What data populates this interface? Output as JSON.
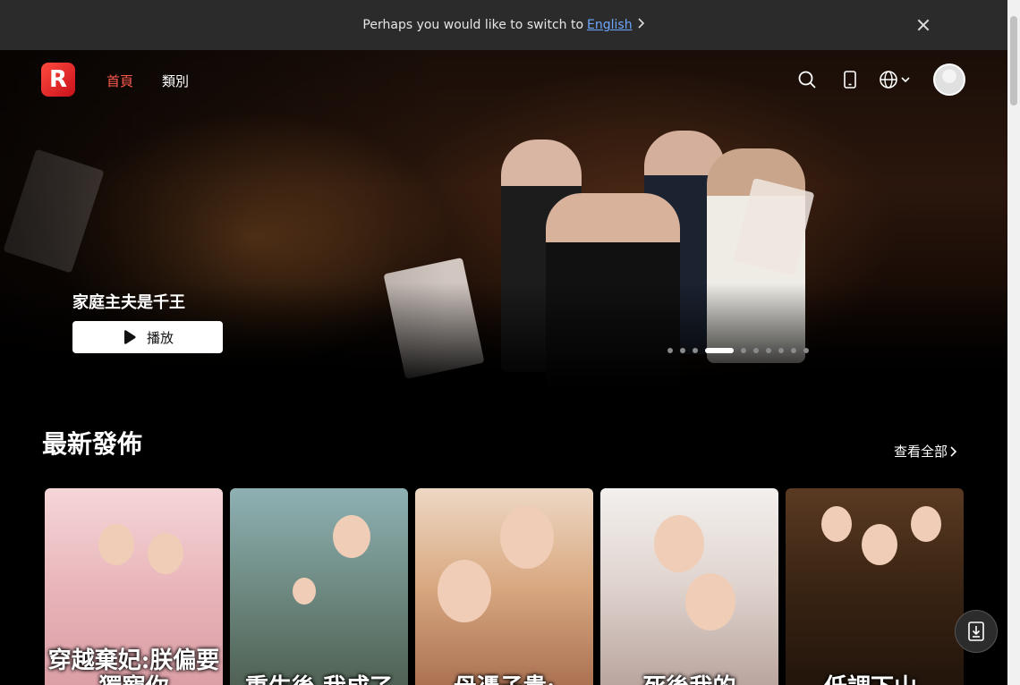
{
  "banner": {
    "text": "Perhaps you would like to switch to",
    "link": "English"
  },
  "nav": {
    "home": "首頁",
    "category": "類別"
  },
  "hero": {
    "title": "家庭主夫是千王",
    "play_label": "播放",
    "slides_total": 10,
    "active_slide": 4
  },
  "section": {
    "title": "最新發佈",
    "view_all": "查看全部"
  },
  "posters": [
    {
      "title": "穿越棄妃:朕偏要獨寵你"
    },
    {
      "title": "重生後,我成了"
    },
    {
      "title": "母憑子貴:"
    },
    {
      "title": "死後我的"
    },
    {
      "title": "低調下山,"
    }
  ],
  "colors": {
    "accent": "#ff5a4f",
    "banner_bg": "#2b2b2b",
    "link": "#6ea6ff"
  }
}
